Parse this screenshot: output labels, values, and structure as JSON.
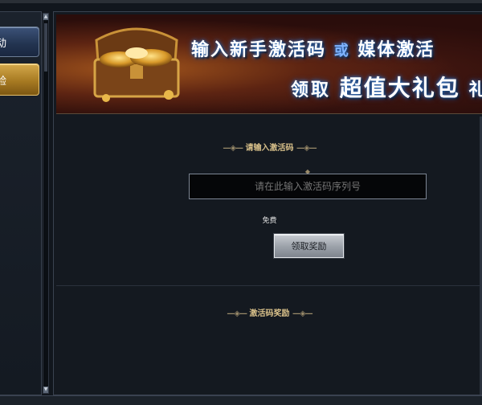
{
  "sidebar": {
    "items": [
      {
        "label": "动",
        "state": "normal"
      },
      {
        "label": "验",
        "state": "selected"
      }
    ]
  },
  "banner": {
    "line1_part1": "输入新手激活码",
    "line1_or": "或",
    "line1_part2": "媒体激活",
    "line2_part1": "领取",
    "line2_big": "超值大礼包",
    "line2_tail": "礼"
  },
  "activation": {
    "section_title": "请输入激活码",
    "input_placeholder": "请在此输入激活码序列号",
    "free_label": "免费",
    "claim_button_label": "领取奖励"
  },
  "rewards": {
    "section_title": "激活码奖励"
  },
  "colors": {
    "accent_gold": "#d8c08a",
    "tab_selected": "#b58a30",
    "tab_normal": "#2d4266"
  }
}
